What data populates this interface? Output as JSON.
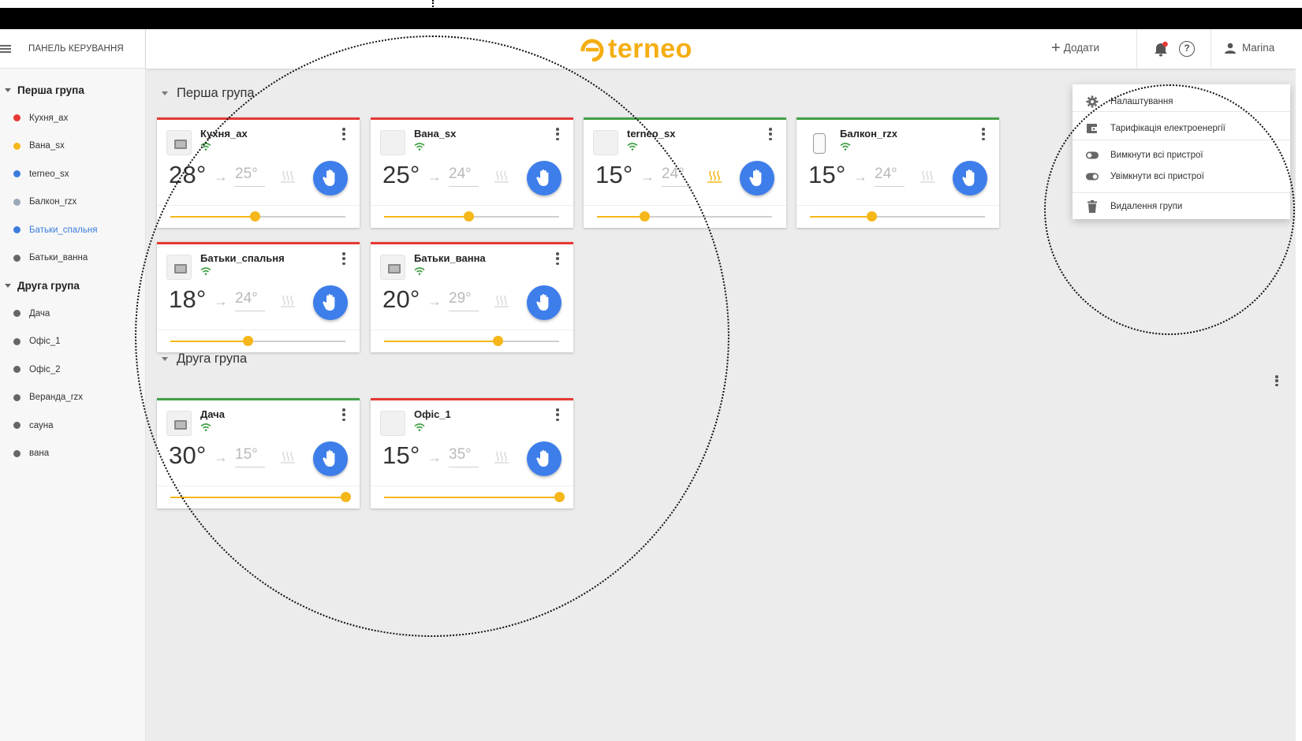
{
  "sidebar": {
    "title": "ПАНЕЛЬ КЕРУВАННЯ",
    "groups": [
      {
        "label": "Перша група",
        "items": [
          {
            "label": "Кухня_ax",
            "color": "#e53935"
          },
          {
            "label": "Вана_sx",
            "color": "#f5b719"
          },
          {
            "label": "terneo_sx",
            "color": "#3b7ddd"
          },
          {
            "label": "Балкон_rzx",
            "color": "#9aa8b8"
          },
          {
            "label": "Батьки_спальня",
            "color": "#3b7ddd"
          },
          {
            "label": "Батьки_ванна",
            "color": "#666666"
          }
        ]
      },
      {
        "label": "Друга група",
        "items": [
          {
            "label": "Дача",
            "color": "#666666"
          },
          {
            "label": "Офіс_1",
            "color": "#666666"
          },
          {
            "label": "Офіс_2",
            "color": "#666666"
          },
          {
            "label": "Веранда_rzx",
            "color": "#666666"
          },
          {
            "label": "сауна",
            "color": "#666666"
          },
          {
            "label": "вана",
            "color": "#666666"
          }
        ]
      }
    ]
  },
  "header": {
    "logo": "terneo",
    "add_label": "Додати",
    "user_name": "Marina"
  },
  "groups": [
    {
      "title": "Перша група",
      "devices": [
        {
          "name": "Кухня_ax",
          "current": "28°",
          "setpoint": "25°",
          "status": "red",
          "heating": false,
          "level": 0.48
        },
        {
          "name": "Вана_sx",
          "current": "25°",
          "setpoint": "24°",
          "status": "red",
          "heating": false,
          "level": 0.48
        },
        {
          "name": "terneo_sx",
          "current": "15°",
          "setpoint": "24°",
          "status": "green",
          "heating": true,
          "level": 0.27
        },
        {
          "name": "Балкон_rzx",
          "current": "15°",
          "setpoint": "24°",
          "status": "green",
          "heating": false,
          "level": 0.35
        },
        {
          "name": "Батьки_спальня",
          "current": "18°",
          "setpoint": "24°",
          "status": "red",
          "heating": false,
          "level": 0.44
        },
        {
          "name": "Батьки_ванна",
          "current": "20°",
          "setpoint": "29°",
          "status": "red",
          "heating": false,
          "level": 0.65
        }
      ]
    },
    {
      "title": "Друга група",
      "devices": [
        {
          "name": "Дача",
          "current": "30°",
          "setpoint": "15°",
          "status": "green",
          "heating": false,
          "level": 1.0
        },
        {
          "name": "Офіс_1",
          "current": "15°",
          "setpoint": "35°",
          "status": "red",
          "heating": false,
          "level": 1.0
        }
      ]
    }
  ],
  "menu": {
    "settings": "Налаштування",
    "tariff": "Тарифікація електроенергії",
    "turn_off_all": "Вимкнути всі пристрої",
    "turn_on_all": "Увімкнути всі пристрої",
    "delete_group": "Видалення групи"
  },
  "colors": {
    "accent": "#f5ae12",
    "primary_blue": "#3e7eea",
    "status_red": "#e53935",
    "status_green": "#43a047",
    "slider": "#f5b719"
  }
}
